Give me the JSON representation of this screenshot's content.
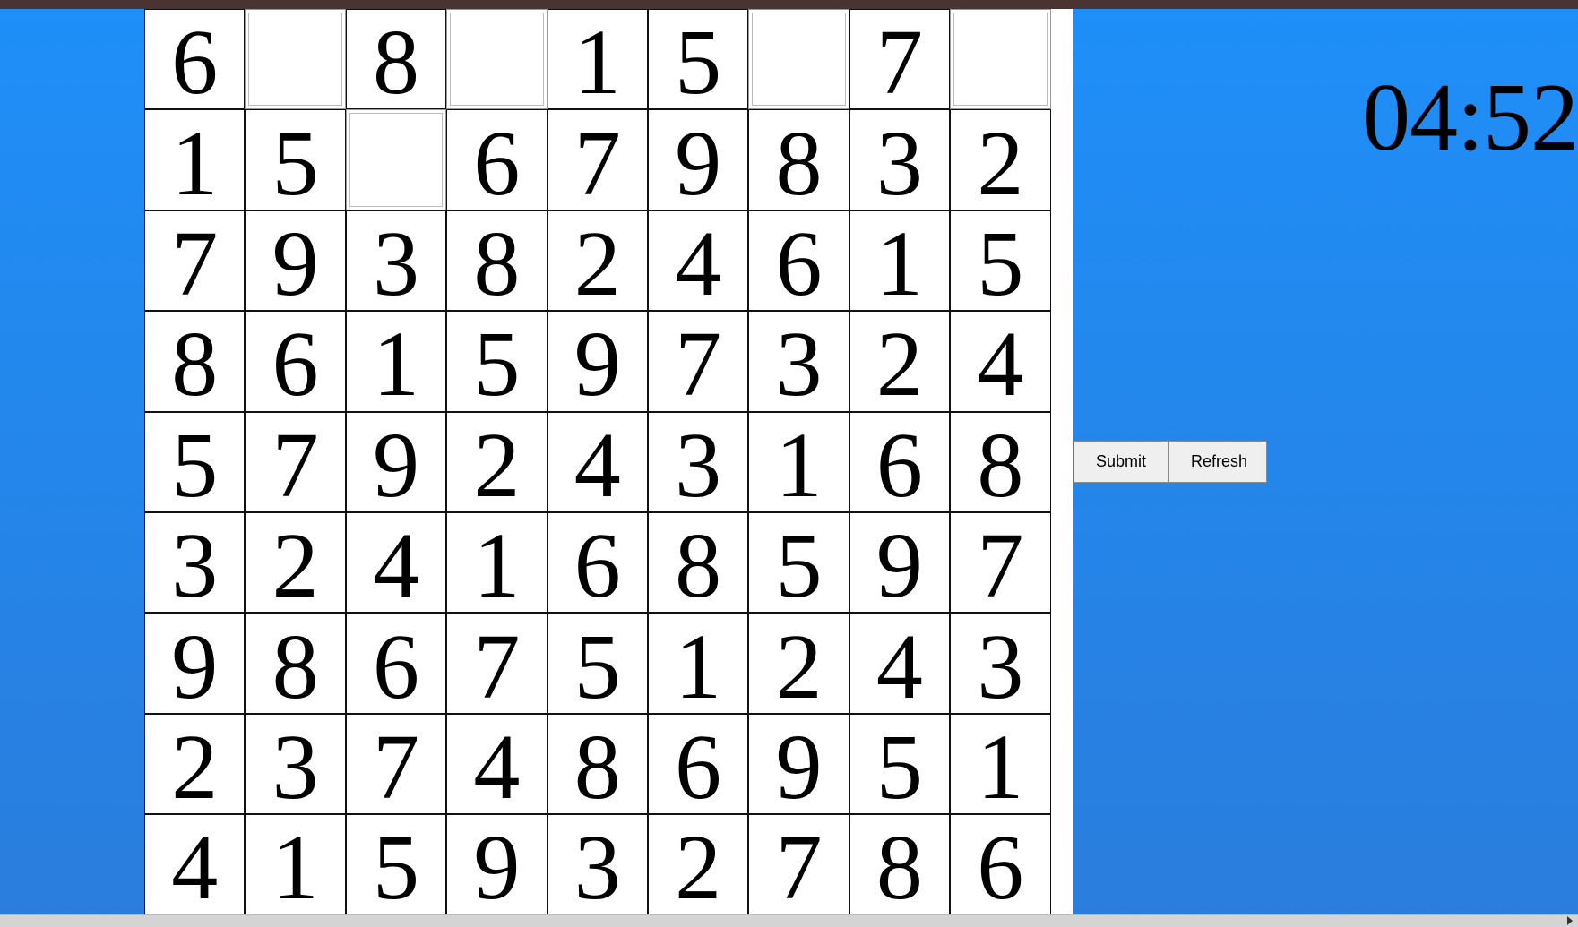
{
  "timer": "04:52",
  "buttons": {
    "submit": "Submit",
    "refresh": "Refresh"
  },
  "board": [
    [
      "6",
      "",
      "8",
      "",
      "1",
      "5",
      "",
      "7",
      ""
    ],
    [
      "1",
      "5",
      "",
      "6",
      "7",
      "9",
      "8",
      "3",
      "2"
    ],
    [
      "7",
      "9",
      "3",
      "8",
      "2",
      "4",
      "6",
      "1",
      "5"
    ],
    [
      "8",
      "6",
      "1",
      "5",
      "9",
      "7",
      "3",
      "2",
      "4"
    ],
    [
      "5",
      "7",
      "9",
      "2",
      "4",
      "3",
      "1",
      "6",
      "8"
    ],
    [
      "3",
      "2",
      "4",
      "1",
      "6",
      "8",
      "5",
      "9",
      "7"
    ],
    [
      "9",
      "8",
      "6",
      "7",
      "5",
      "1",
      "2",
      "4",
      "3"
    ],
    [
      "2",
      "3",
      "7",
      "4",
      "8",
      "6",
      "9",
      "5",
      "1"
    ],
    [
      "4",
      "1",
      "5",
      "9",
      "3",
      "2",
      "7",
      "8",
      "6"
    ]
  ],
  "colors": {
    "background_top": "#1e8ff8",
    "background_bottom": "#2a7ddc",
    "top_bar": "#4a3431"
  }
}
